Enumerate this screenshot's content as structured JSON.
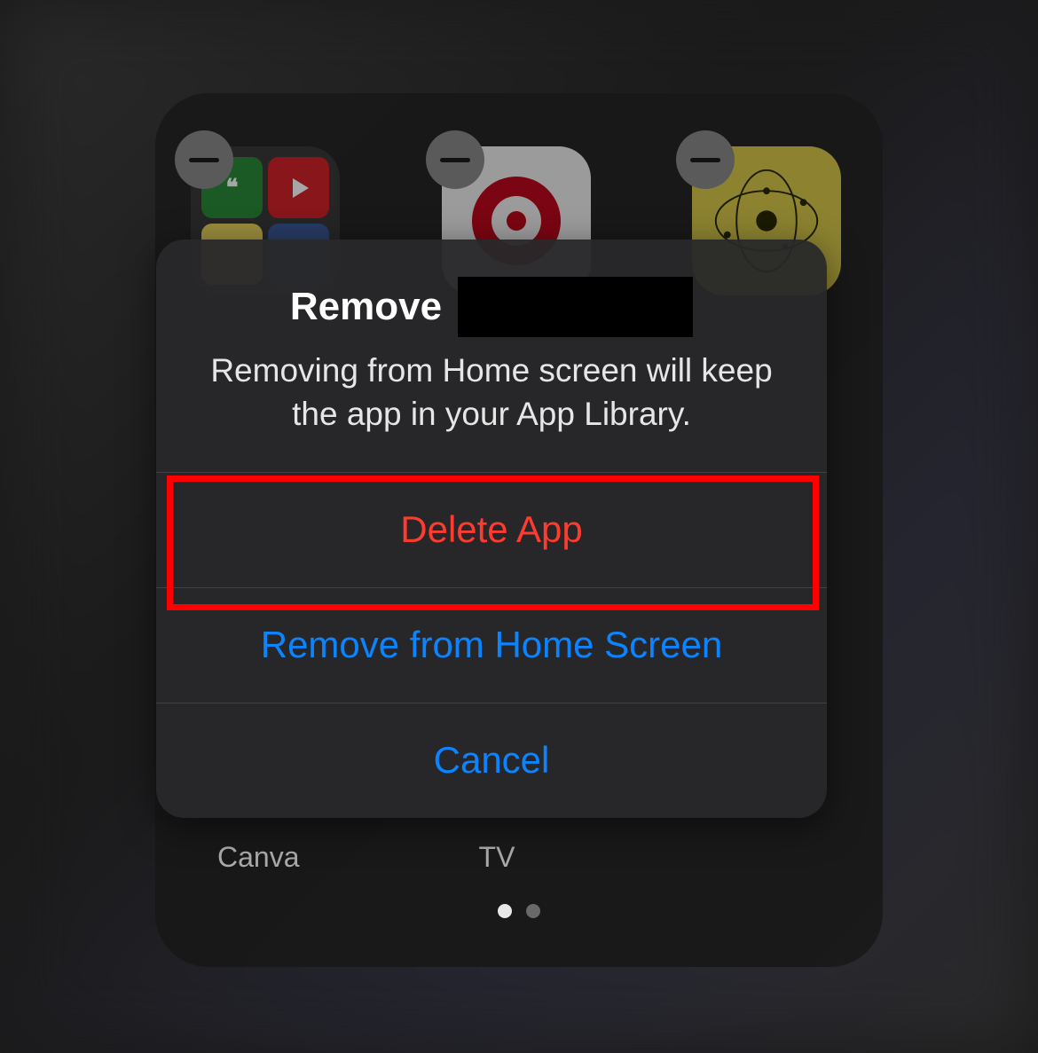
{
  "folder": {
    "app_labels": [
      "Canva",
      "TV"
    ],
    "page_count": 2,
    "active_page": 0,
    "icons": [
      {
        "type": "folder",
        "name": "social-folder"
      },
      {
        "type": "pinterest",
        "name": "pinterest-app"
      },
      {
        "type": "planets",
        "name": "astrology-app"
      }
    ]
  },
  "alert": {
    "title_prefix": "Remove",
    "message": "Removing from Home screen will keep the app in your App Library.",
    "buttons": {
      "delete": "Delete App",
      "remove": "Remove from Home Screen",
      "cancel": "Cancel"
    }
  }
}
